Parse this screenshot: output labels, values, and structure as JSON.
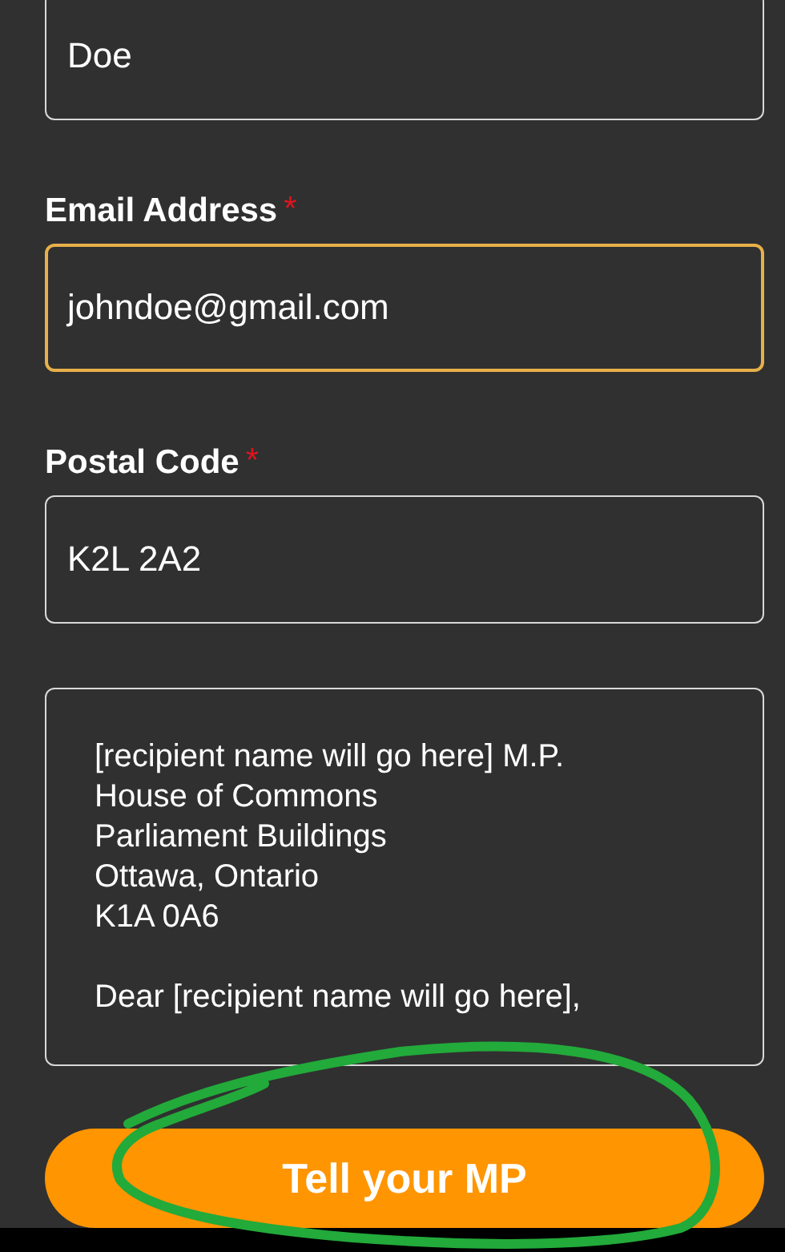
{
  "fields": [
    {
      "value": "Doe",
      "focused": false
    },
    {
      "label": "Email Address",
      "required_mark": "*",
      "value": "johndoe@gmail.com",
      "focused": true
    },
    {
      "label": "Postal Code",
      "required_mark": "*",
      "value": "K2L 2A2",
      "focused": false
    }
  ],
  "letter": {
    "paragraphs": [
      {
        "lines": [
          "[recipient name will go here] M.P.",
          "House of Commons",
          "Parliament Buildings",
          "Ottawa, Ontario",
          "K1A 0A6"
        ]
      },
      {
        "lines": [
          "Dear [recipient name will go here],"
        ]
      }
    ]
  },
  "submit": {
    "label": "Tell your MP"
  },
  "annotation": {
    "kind": "circle"
  }
}
